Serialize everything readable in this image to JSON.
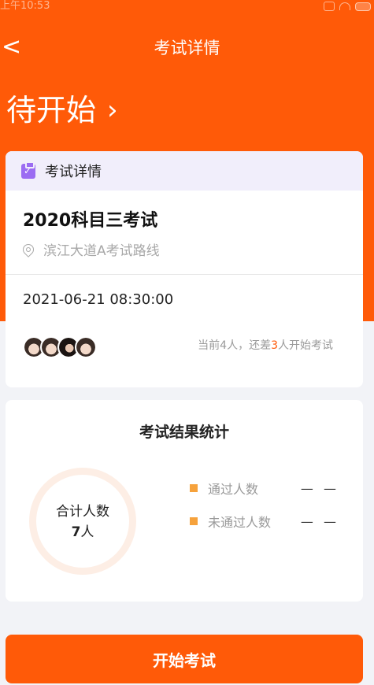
{
  "status_bar": {
    "time": "上午10:53"
  },
  "nav": {
    "back": "<",
    "title": "考试详情"
  },
  "exam_status": {
    "label": "待开始",
    "chevron": "›"
  },
  "detail_card": {
    "header": "考试详情",
    "header_icon": "clipboard-check-icon",
    "exam_title": "2020科目三考试",
    "location": "滨江大道A考试路线",
    "datetime": "2021-06-21 08:30:00",
    "participants_prefix": "当前4人，还差",
    "participants_missing": "3",
    "participants_suffix": "人开始考试",
    "avatar_count": 4
  },
  "stats_card": {
    "title": "考试结果统计",
    "total_label": "合计人数",
    "total_value": "7",
    "total_unit": "人",
    "legend": [
      {
        "label": "通过人数",
        "value": "— —"
      },
      {
        "label": "未通过人数",
        "value": "— —"
      }
    ],
    "legend_color": "#f6a23c"
  },
  "primary_action": {
    "label": "开始考试"
  },
  "colors": {
    "brand": "#ff5a08",
    "accent_purple": "#9b6cf2",
    "donut_ring": "#fdeee5"
  }
}
